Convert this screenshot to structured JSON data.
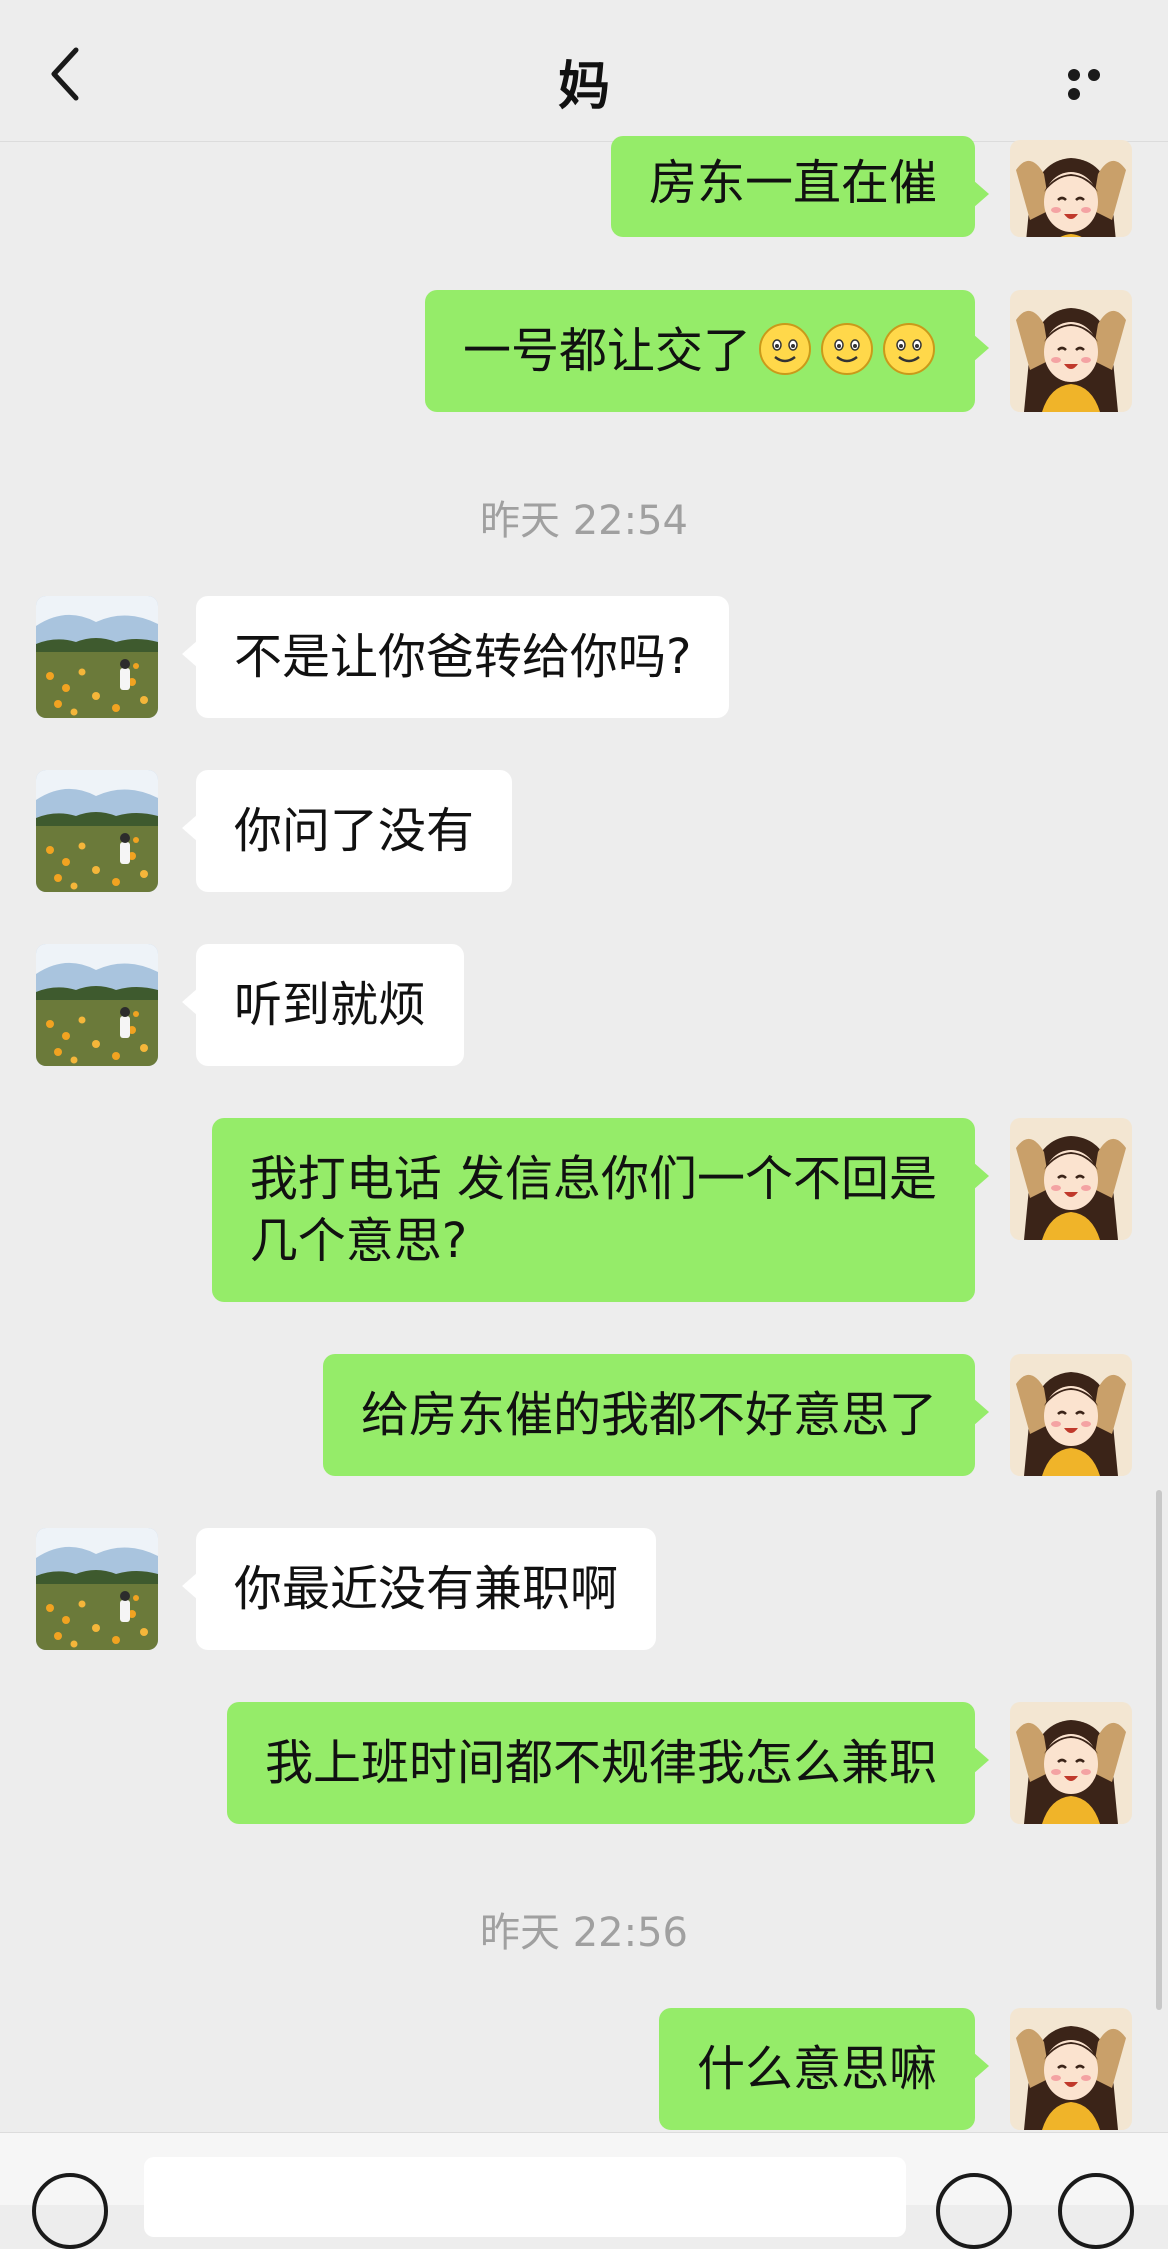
{
  "header": {
    "title": "妈",
    "back_icon": "chevron-left-icon",
    "more_icon": "more-dots-icon"
  },
  "messages": [
    {
      "from": "me",
      "text": "房东一直在催"
    },
    {
      "from": "me",
      "text": "一号都让交了",
      "emojis": [
        "smile-emoji",
        "smile-emoji",
        "smile-emoji"
      ]
    },
    {
      "type": "timestamp",
      "text": "昨天 22:54"
    },
    {
      "from": "them",
      "text": "不是让你爸转给你吗?"
    },
    {
      "from": "them",
      "text": "你问了没有"
    },
    {
      "from": "them",
      "text": "听到就烦"
    },
    {
      "from": "me",
      "lines": [
        "我打电话 发信息你们一个不回是",
        "几个意思?"
      ]
    },
    {
      "from": "me",
      "text": "给房东催的我都不好意思了"
    },
    {
      "from": "them",
      "text": "你最近没有兼职啊"
    },
    {
      "from": "me",
      "text": "我上班时间都不规律我怎么兼职"
    },
    {
      "type": "timestamp",
      "text": "昨天 22:56"
    },
    {
      "from": "me",
      "text": "什么意思嘛"
    }
  ],
  "input_bar": {
    "voice_icon": "voice-icon",
    "emoji_icon": "emoji-icon",
    "plus_icon": "plus-icon"
  },
  "colors": {
    "my_bubble": "#95ec69",
    "their_bubble": "#ffffff",
    "background": "#ededed"
  }
}
